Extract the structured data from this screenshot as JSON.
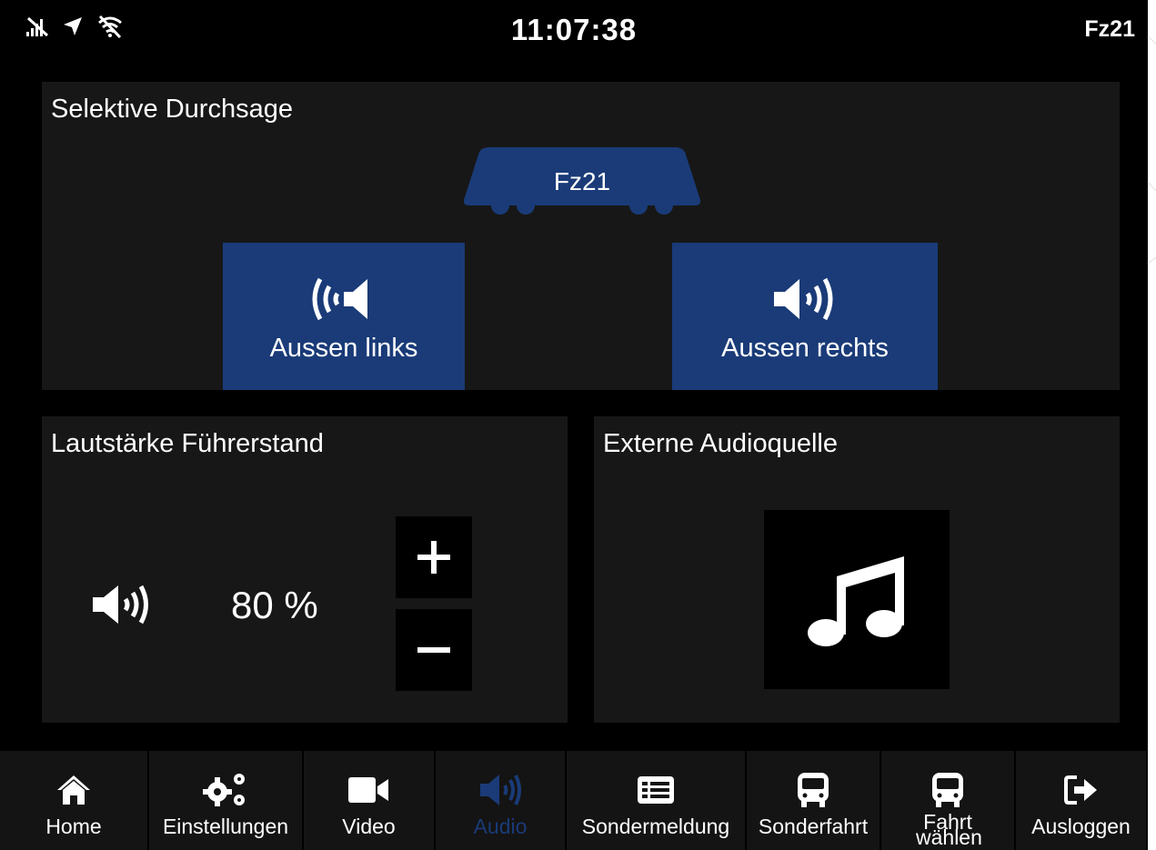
{
  "status_bar": {
    "icons": [
      "no-signal-icon",
      "location-arrow-icon",
      "wifi-off-icon"
    ],
    "clock": "11:07:38",
    "vehicle_id": "Fz21"
  },
  "selective_announcement": {
    "title": "Selektive Durchsage",
    "vehicle_label": "Fz21",
    "left_button_label": "Aussen links",
    "right_button_label": "Aussen rechts"
  },
  "volume_panel": {
    "title": "Lautstärke Führerstand",
    "value_text": "80 %",
    "volume_percent": 80
  },
  "external_audio_panel": {
    "title": "Externe Audioquelle",
    "icon": "music-note-icon"
  },
  "navigation": {
    "active": "Audio",
    "items": [
      {
        "label": "Home",
        "icon": "home-icon"
      },
      {
        "label": "Einstellungen",
        "icon": "gears-icon"
      },
      {
        "label": "Video",
        "icon": "video-camera-icon"
      },
      {
        "label": "Audio",
        "icon": "speaker-icon"
      },
      {
        "label": "Sondermeldung",
        "icon": "message-list-icon"
      },
      {
        "label": "Sonderfahrt",
        "icon": "bus-icon"
      },
      {
        "label": "Fahrt wählen",
        "icon": "bus-icon"
      },
      {
        "label": "Ausloggen",
        "icon": "logout-icon"
      }
    ]
  },
  "colors": {
    "accent": "#1a3b78",
    "panel_background": "#171717",
    "screen_background": "#000000",
    "text": "#ffffff"
  }
}
